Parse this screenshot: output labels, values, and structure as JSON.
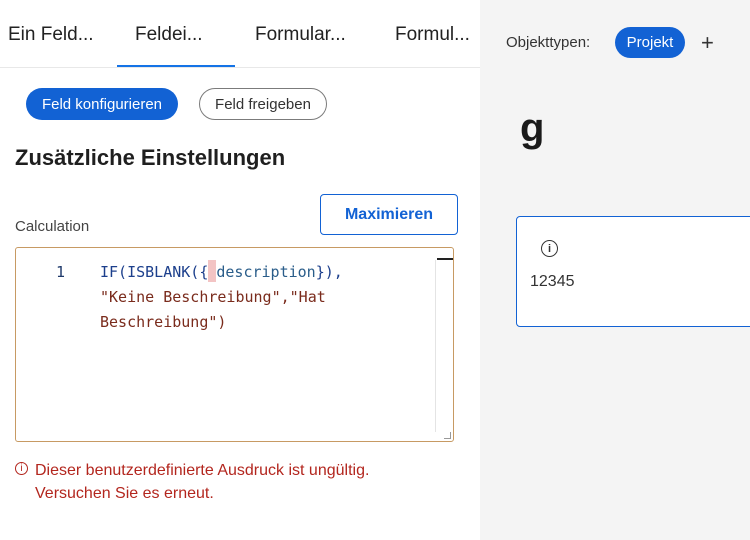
{
  "tabs": [
    {
      "label": "Ein Feld..."
    },
    {
      "label": "Feldei..."
    },
    {
      "label": "Formular..."
    },
    {
      "label": "Formul..."
    }
  ],
  "actions": {
    "configure_label": "Feld konfigurieren",
    "share_label": "Feld freigeben"
  },
  "section": {
    "title": "Zusätzliche Einstellungen",
    "maximize_label": "Maximieren",
    "field_label": "Calculation"
  },
  "editor": {
    "line_number": "1",
    "tokens": {
      "fn": "IF(ISBLANK({",
      "var": "description",
      "fn_close": "}),",
      "string_line2": "\"Keine Beschreibung\",\"Hat",
      "string_line3": "Beschreibung\")"
    }
  },
  "error": {
    "message": "Dieser benutzerdefinierte Ausdruck ist ungültig.\nVersuchen Sie es erneut."
  },
  "right_panel": {
    "object_types_label": "Objekttypen:",
    "chip_label": "Projekt",
    "add_symbol": "+",
    "preview_title": "g",
    "card_value": "12345"
  },
  "colors": {
    "accent": "#1262d4",
    "error": "#b3261e",
    "editor_border": "#c79a63"
  },
  "icons": [
    "info-icon",
    "error-icon",
    "plus-icon",
    "scroll-up-arrow"
  ]
}
